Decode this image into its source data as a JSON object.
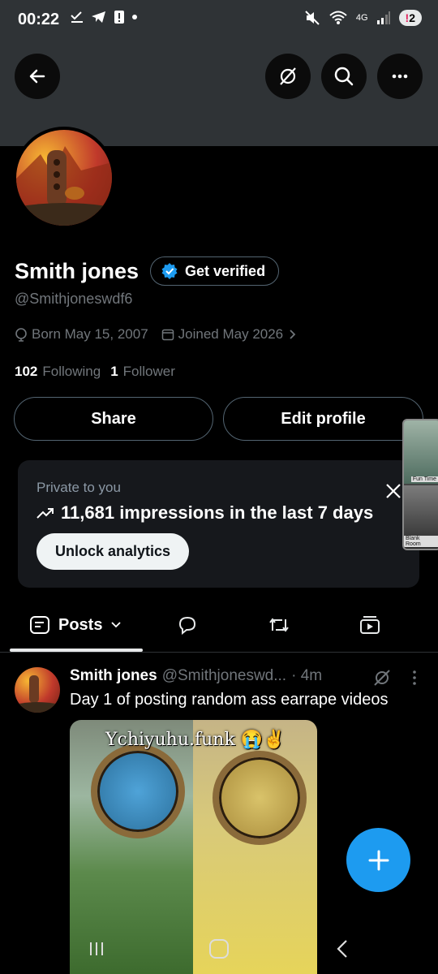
{
  "status_bar": {
    "time": "00:22",
    "network": "4G",
    "notification_count": "2",
    "notification_mark": "!"
  },
  "profile": {
    "display_name": "Smith jones",
    "get_verified_label": "Get verified",
    "handle": "@Smithjoneswdf6",
    "born": "Born May 15, 2007",
    "joined": "Joined May 2026",
    "following_count": "102",
    "following_label": "Following",
    "followers_count": "1",
    "followers_label": "Follower",
    "share_label": "Share",
    "edit_profile_label": "Edit profile"
  },
  "pip": {
    "label_top": "Fun Time",
    "label_bottom": "Blank Room"
  },
  "analytics": {
    "private_label": "Private to you",
    "impressions_text": "11,681 impressions in the last 7 days",
    "unlock_label": "Unlock analytics"
  },
  "tabs": {
    "posts_label": "Posts"
  },
  "tweet": {
    "author_name": "Smith jones",
    "author_handle": "@Smithjoneswd...",
    "time": "· 4m",
    "text": "Day 1 of posting random ass earrape videos",
    "media_caption": "Ychiyuhu.funk 😭✌️"
  },
  "colors": {
    "accent": "#1d9bf0",
    "background": "#000000",
    "banner": "#2f3336",
    "muted_text": "#71767b"
  },
  "icons": [
    "back-arrow-icon",
    "grok-icon",
    "search-icon",
    "more-icon",
    "verified-badge-icon",
    "location-icon",
    "calendar-icon",
    "chevron-right-icon",
    "trend-up-icon",
    "close-icon",
    "posts-icon",
    "chevron-down-icon",
    "replies-icon",
    "reposts-icon",
    "media-icon",
    "plus-icon"
  ]
}
